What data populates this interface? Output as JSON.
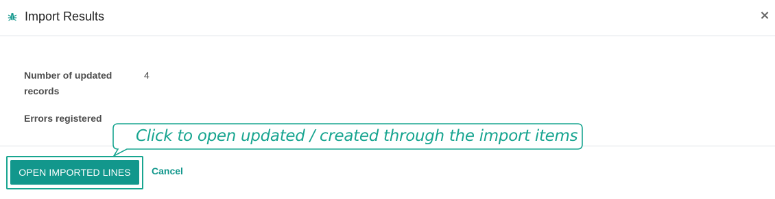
{
  "dialog": {
    "title": "Import Results",
    "close_symbol": "×",
    "header_icon": "bug-icon"
  },
  "fields": {
    "updated_label": "Number of updated records",
    "updated_value": "4",
    "errors_label": "Errors registered"
  },
  "footer": {
    "primary_label": "OPEN IMPORTED LINES",
    "cancel_label": "Cancel"
  },
  "callout": {
    "text": "Click to open updated / created through the import items"
  },
  "colors": {
    "accent": "#12978c",
    "callout": "#18a590"
  }
}
